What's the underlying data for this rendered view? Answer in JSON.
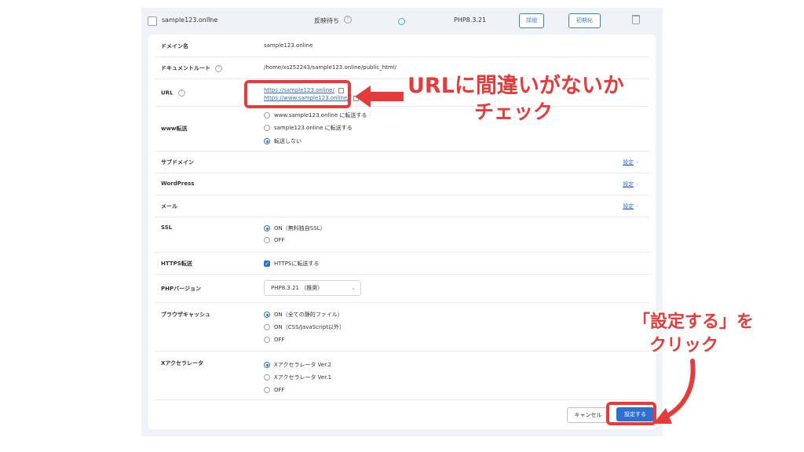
{
  "header": {
    "domain": "sample123.online",
    "status": "反映待ち",
    "php": "PHP8.3.21",
    "detail_button": "詳細",
    "reset_button": "初期化",
    "edit_icon": "pencil-icon",
    "trash_icon": "trash-icon"
  },
  "rows": {
    "domain": {
      "label": "ドメイン名",
      "value": "sample123.online"
    },
    "docroot": {
      "label": "ドキュメントルート",
      "value": "/home/xs252243/sample123.online/public_html/"
    },
    "url": {
      "label": "URL",
      "link1": "https://sample123.online/",
      "link2": "https://www.sample123.online/"
    },
    "www": {
      "label": "www転送",
      "options": [
        "www.sample123.online に転送する",
        "sample123.online に転送する",
        "転送しない"
      ],
      "selected": 2
    },
    "subdomain": {
      "label": "サブドメイン",
      "link": "設定"
    },
    "wordpress": {
      "label": "WordPress",
      "link": "設定"
    },
    "mail": {
      "label": "メール",
      "link": "設定"
    },
    "ssl": {
      "label": "SSL",
      "options": [
        "ON（無料独自SSL）",
        "OFF"
      ],
      "selected": 0
    },
    "https": {
      "label": "HTTPS転送",
      "checkbox": "HTTPSに転送する",
      "checked": true
    },
    "php": {
      "label": "PHPバージョン",
      "value": "PHP8.3.21 （推奨）"
    },
    "cache": {
      "label": "ブラウザキャッシュ",
      "options": [
        "ON（全ての静的ファイル）",
        "ON（CSS/JavaScript以外）",
        "OFF"
      ],
      "selected": 0
    },
    "xacc": {
      "label": "Xアクセラレータ",
      "options": [
        "Xアクセラレータ Ver.2",
        "Xアクセラレータ Ver.1",
        "OFF"
      ],
      "selected": 0
    }
  },
  "buttons": {
    "cancel": "キャンセル",
    "save": "設定する"
  },
  "annotations": {
    "url_line1": "URLに間違いがないか",
    "url_line2": "チェック",
    "save_line1": "「設定する」を",
    "save_line2": "クリック"
  },
  "colors": {
    "accent": "#2f6fd1",
    "annotation": "#e53b3b",
    "teal": "#33b8a8"
  }
}
